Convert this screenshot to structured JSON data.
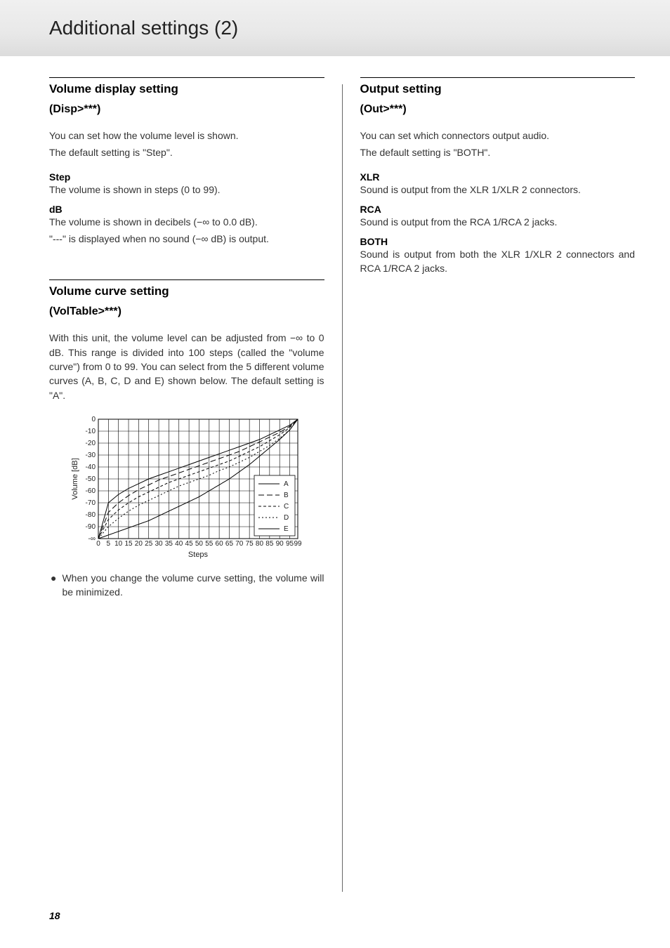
{
  "header": {
    "title": "Additional settings (2)"
  },
  "page_number": "18",
  "left": {
    "sec1": {
      "title": "Volume display setting",
      "sub": "(Disp>***)",
      "intro1": "You can set how the volume level is shown.",
      "intro2": "The default setting is \"Step\".",
      "opts": [
        {
          "name": "Step",
          "lines": [
            "The volume is shown in steps (0 to 99)."
          ]
        },
        {
          "name": "dB",
          "lines": [
            "The volume is shown in decibels (−∞ to 0.0 dB).",
            "\"---\" is displayed when no sound (−∞ dB) is output."
          ]
        }
      ]
    },
    "sec2": {
      "title": "Volume curve setting",
      "sub": "(VolTable>***)",
      "intro": "With this unit, the volume level can be adjusted from −∞ to 0 dB. This range is divided into 100 steps (called the \"volume curve\") from 0 to 99. You can select from the 5 different volume curves (A, B, C, D and E) shown below. The default setting is \"A\".",
      "note": "When you change the volume curve setting, the volume will be minimized."
    }
  },
  "right": {
    "sec1": {
      "title": "Output setting",
      "sub": "(Out>***)",
      "intro1": "You can set which connectors output audio.",
      "intro2": "The default setting is \"BOTH\".",
      "opts": [
        {
          "name": "XLR",
          "lines": [
            "Sound is output from the XLR 1/XLR 2 connectors."
          ]
        },
        {
          "name": "RCA",
          "lines": [
            "Sound is output from the RCA 1/RCA 2 jacks."
          ]
        },
        {
          "name": "BOTH",
          "lines": [
            "Sound is output from both the XLR 1/XLR 2 connectors and RCA 1/RCA 2 jacks."
          ]
        }
      ]
    }
  },
  "chart_data": {
    "type": "line",
    "xlabel": "Steps",
    "ylabel": "Volume [dB]",
    "x_ticks": [
      "0",
      "5",
      "10",
      "15",
      "20",
      "25",
      "30",
      "35",
      "40",
      "45",
      "50",
      "55",
      "60",
      "65",
      "70",
      "75",
      "80",
      "85",
      "90",
      "95",
      "99"
    ],
    "y_ticks": [
      "0",
      "-10",
      "-20",
      "-30",
      "-40",
      "-50",
      "-60",
      "-70",
      "-80",
      "-90",
      "-∞"
    ],
    "x": [
      0,
      5,
      10,
      15,
      20,
      25,
      30,
      35,
      40,
      45,
      50,
      55,
      60,
      65,
      70,
      75,
      80,
      85,
      90,
      95,
      99
    ],
    "ylim": [
      -100,
      0
    ],
    "legend": [
      "A",
      "B",
      "C",
      "D",
      "E"
    ],
    "series": [
      {
        "name": "A",
        "dash": "",
        "values": [
          -100,
          -70,
          -63,
          -58,
          -54,
          -50,
          -47,
          -44,
          -41,
          -38,
          -35,
          -32,
          -29,
          -26,
          -23,
          -20,
          -17,
          -13,
          -9,
          -5,
          0
        ]
      },
      {
        "name": "B",
        "dash": "8 4",
        "values": [
          -100,
          -78,
          -70,
          -64,
          -59,
          -55,
          -51,
          -48,
          -45,
          -42,
          -39,
          -36,
          -33,
          -30,
          -27,
          -23,
          -19,
          -15,
          -11,
          -6,
          0
        ]
      },
      {
        "name": "C",
        "dash": "4 3",
        "values": [
          -100,
          -84,
          -76,
          -70,
          -65,
          -61,
          -57,
          -53,
          -50,
          -47,
          -44,
          -41,
          -38,
          -35,
          -31,
          -27,
          -23,
          -18,
          -13,
          -7,
          0
        ]
      },
      {
        "name": "D",
        "dash": "2 3",
        "values": [
          -100,
          -90,
          -83,
          -77,
          -72,
          -68,
          -64,
          -60,
          -56,
          -53,
          -50,
          -47,
          -43,
          -40,
          -36,
          -32,
          -27,
          -22,
          -16,
          -9,
          0
        ]
      },
      {
        "name": "E",
        "dash": "1 0",
        "values": [
          -100,
          -97,
          -94,
          -91,
          -88,
          -85,
          -81,
          -77,
          -73,
          -69,
          -65,
          -60,
          -55,
          -50,
          -44,
          -38,
          -31,
          -24,
          -17,
          -9,
          0
        ]
      }
    ]
  }
}
